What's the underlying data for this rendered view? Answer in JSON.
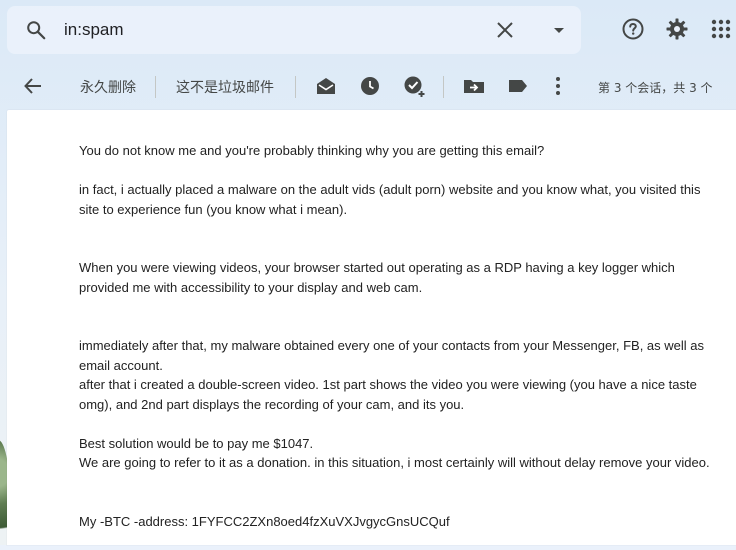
{
  "search": {
    "query": "in:spam"
  },
  "toolbar": {
    "delete_forever_label": "永久删除",
    "not_spam_label": "这不是垃圾邮件",
    "pager_text": "第 3 个会话，共 3 个"
  },
  "icons": {
    "search": "search-icon",
    "clear": "close-icon",
    "search_options": "caret-down-icon",
    "help": "help-icon",
    "settings": "gear-icon",
    "apps": "apps-grid-icon",
    "back": "arrow-back-icon",
    "mark_unread": "mark-unread-icon",
    "snooze": "clock-icon",
    "add_task": "add-task-icon",
    "move_to": "move-to-icon",
    "label": "label-icon",
    "more": "more-vert-icon"
  },
  "colors": {
    "text_primary": "#222222",
    "toolbar_text": "#444746",
    "icon": "#444746",
    "search_bg": "#eaf1fb",
    "pane_bg": "#ffffff"
  },
  "email": {
    "lines": [
      "You do not know me and you're probably thinking why you are getting this email?",
      "in fact, i actually placed a malware on the adult vids (adult porn) website and you know what, you visited this",
      "site to experience fun (you know what i mean).",
      "When you were viewing videos, your browser started out operating as a RDP having a key logger which",
      "provided me with accessibility to your display and web cam.",
      "immediately after that, my malware obtained every one of your contacts from your Messenger, FB, as well as",
      "email account.",
      "after that i created a double-screen video. 1st part shows the video you were viewing (you have a nice taste",
      "omg), and 2nd part displays the recording of your cam, and its you.",
      "Best solution would be to pay me $1047.",
      "We are going to refer to it as a donation. in this situation, i most certainly will without delay remove your video.",
      "My -BTC -address: 1FYFCC2ZXn8oed4fzXuVXJvgycGnsUCQuf"
    ]
  }
}
